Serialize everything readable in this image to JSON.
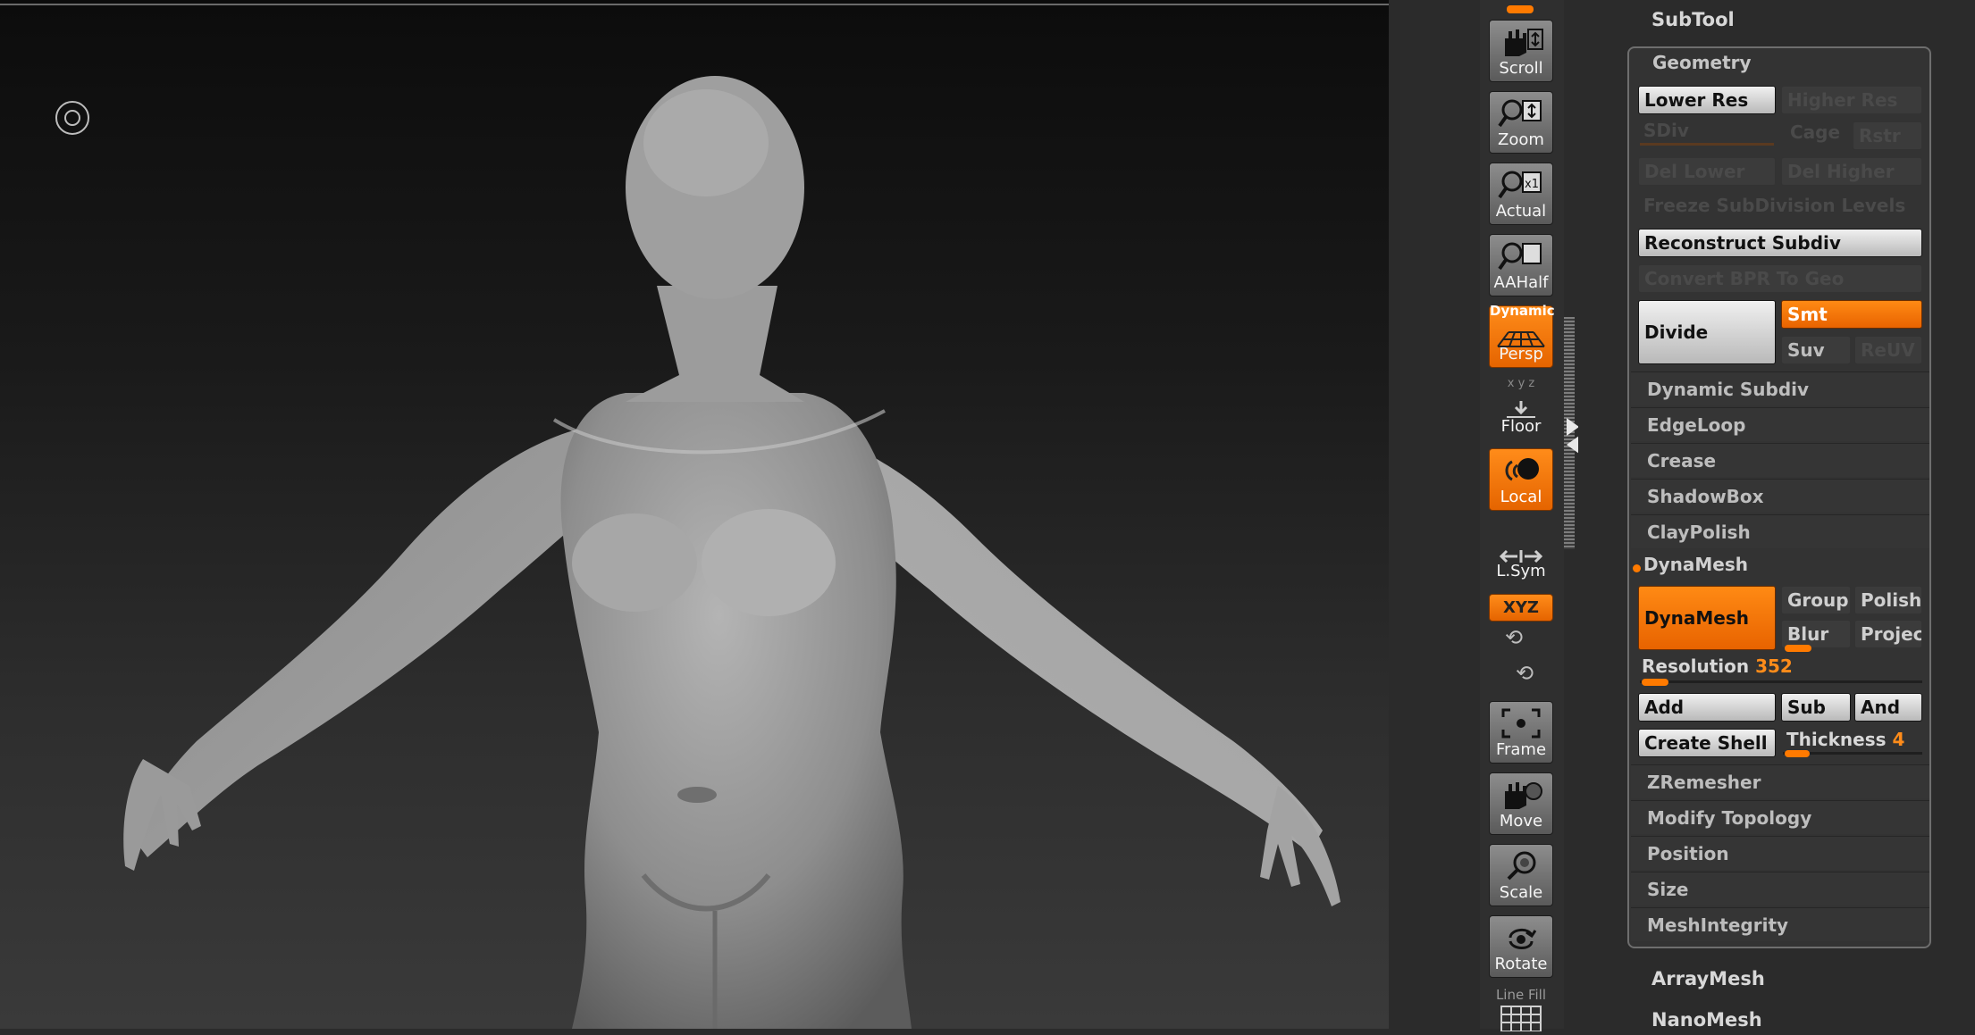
{
  "shelf": {
    "scroll": "Scroll",
    "zoom": "Zoom",
    "actual": "Actual",
    "aahalf": "AAHalf",
    "persp_sup": "Dynamic",
    "persp": "Persp",
    "floor": "Floor",
    "floor_axes": "x y z",
    "local": "Local",
    "lsym": "L.Sym",
    "xyz": "XYZ",
    "frame": "Frame",
    "move": "Move",
    "scale": "Scale",
    "rotate": "Rotate",
    "line_fill": "Line Fill"
  },
  "panel": {
    "subtool": "SubTool",
    "geometry": "Geometry",
    "lower_res": "Lower Res",
    "higher_res": "Higher Res",
    "sdiv": "SDiv",
    "cage": "Cage",
    "rstr": "Rstr",
    "del_lower": "Del Lower",
    "del_higher": "Del Higher",
    "freeze": "Freeze SubDivision Levels",
    "reconstruct": "Reconstruct Subdiv",
    "convert_bpr": "Convert BPR To Geo",
    "divide": "Divide",
    "smt": "Smt",
    "suv": "Suv",
    "reuv": "ReUV",
    "items_a": [
      "Dynamic Subdiv",
      "EdgeLoop",
      "Crease",
      "ShadowBox",
      "ClayPolish"
    ],
    "dynamesh_section": "DynaMesh",
    "dynamesh_btn": "DynaMesh",
    "group": "Group",
    "polish": "Polish",
    "blur": "Blur",
    "project": "Project",
    "resolution_label": "Resolution",
    "resolution_value": "352",
    "add": "Add",
    "sub": "Sub",
    "and": "And",
    "create_shell": "Create Shell",
    "thickness_label": "Thickness",
    "thickness_value": "4",
    "items_b": [
      "ZRemesher",
      "Modify Topology",
      "Position",
      "Size",
      "MeshIntegrity"
    ],
    "arraymesh": "ArrayMesh",
    "nanomesh": "NanoMesh"
  },
  "colors": {
    "accent": "#ff7a00",
    "panel_bg": "#2b2b2b",
    "button_light": "#d9d9d9"
  }
}
